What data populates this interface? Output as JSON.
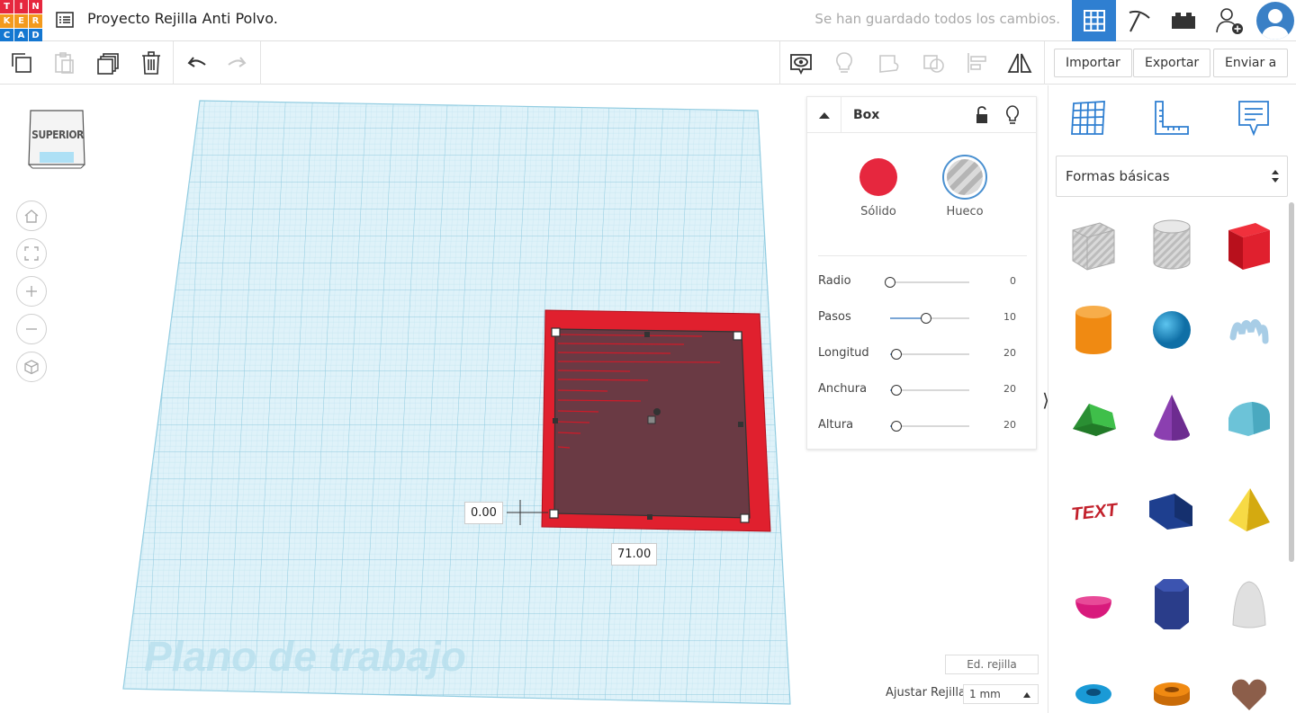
{
  "app": {
    "logo_letters": [
      "T",
      "I",
      "N",
      "K",
      "E",
      "R",
      "C",
      "A",
      "D"
    ],
    "logo_colors": [
      "#e6273e",
      "#e6273e",
      "#e6273e",
      "#f39a1d",
      "#f39a1d",
      "#f39a1d",
      "#1477d1",
      "#1477d1",
      "#1477d1"
    ],
    "project_title": "Proyecto Rejilla Anti Polvo.",
    "save_status": "Se han guardado todos los cambios."
  },
  "toolbar": {
    "import_label": "Importar",
    "export_label": "Exportar",
    "send_label": "Enviar a"
  },
  "viewcube": {
    "label": "SUPERIOR"
  },
  "workplane": {
    "watermark": "Plano de trabajo",
    "dim_left": "0.00",
    "dim_bottom": "71.00",
    "grid_color": "#a8d8ea",
    "shape_color": "#e0202e"
  },
  "inspector": {
    "title": "Box",
    "solid_label": "Sólido",
    "hole_label": "Hueco",
    "solid_color": "#e6273e",
    "params": [
      {
        "name": "Radio",
        "value": "0",
        "fraction": 0.0
      },
      {
        "name": "Pasos",
        "value": "10",
        "fraction": 0.45
      },
      {
        "name": "Longitud",
        "value": "20",
        "fraction": 0.08
      },
      {
        "name": "Anchura",
        "value": "20",
        "fraction": 0.08
      },
      {
        "name": "Altura",
        "value": "20",
        "fraction": 0.08
      }
    ]
  },
  "grid_settings": {
    "edit_label": "Ed. rejilla",
    "snap_label": "Ajustar Rejilla",
    "snap_value": "1 mm"
  },
  "shapes_panel": {
    "category": "Formas básicas",
    "shapes": [
      {
        "name": "box-hole",
        "color": "#c9c9c9"
      },
      {
        "name": "cylinder-hole",
        "color": "#c9c9c9"
      },
      {
        "name": "box",
        "color": "#e0202e"
      },
      {
        "name": "cylinder",
        "color": "#f08a12"
      },
      {
        "name": "sphere",
        "color": "#1a9ad6"
      },
      {
        "name": "scribble",
        "color": "#a8cde6"
      },
      {
        "name": "roof",
        "color": "#2fa43a"
      },
      {
        "name": "cone",
        "color": "#8b3fb0"
      },
      {
        "name": "round-roof",
        "color": "#6cc3d8"
      },
      {
        "name": "text",
        "color": "#c2202b"
      },
      {
        "name": "wedge",
        "color": "#1e3f8f"
      },
      {
        "name": "pyramid",
        "color": "#f2c81c"
      },
      {
        "name": "half-sphere",
        "color": "#d81a7c"
      },
      {
        "name": "polygon",
        "color": "#2a3d8a"
      },
      {
        "name": "paraboloid",
        "color": "#e0e0e0"
      },
      {
        "name": "torus",
        "color": "#1a9ad6"
      },
      {
        "name": "tube",
        "color": "#f08a12"
      },
      {
        "name": "heart",
        "color": "#8c5e4a"
      }
    ]
  }
}
